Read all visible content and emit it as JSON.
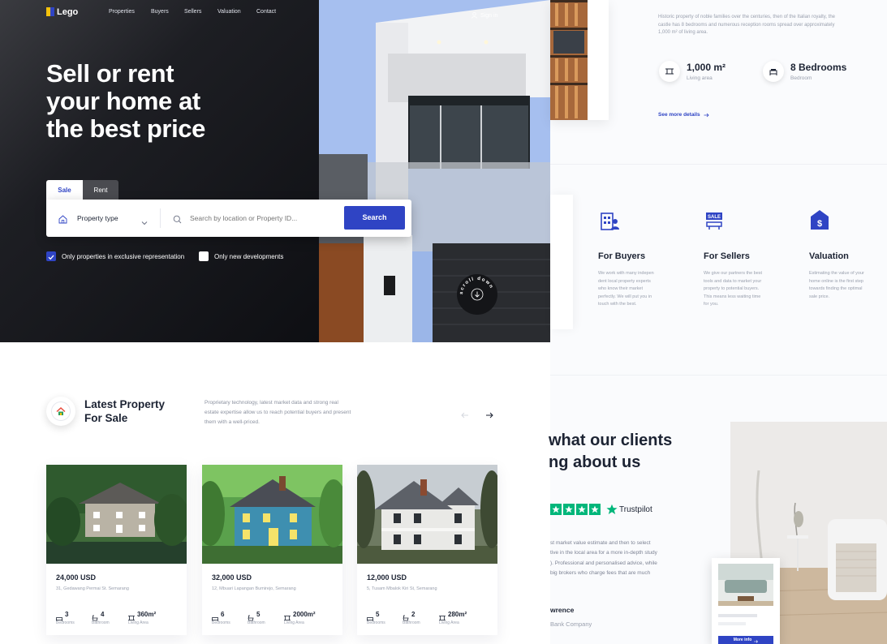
{
  "brand": {
    "name": "Lego"
  },
  "nav": {
    "items": [
      "Properties",
      "Buyers",
      "Sellers",
      "Valuation",
      "Contact"
    ],
    "sign_in": "Sign in"
  },
  "hero": {
    "title_lines": [
      "Sell or rent",
      "your home at",
      "the best price"
    ],
    "scroll_label": "scroll down"
  },
  "search": {
    "tabs": [
      "Sale",
      "Rent"
    ],
    "property_type": "Property type",
    "placeholder": "Search by location or Property ID...",
    "button": "Search",
    "checks": [
      {
        "label": "Only properties in exclusive representation",
        "checked": true
      },
      {
        "label": "Only new developments",
        "checked": false
      }
    ]
  },
  "detail": {
    "description": "Historic property of noble families over the centuries, then of the Italian royalty, the castle has 8 bedrooms and numerous reception rooms spread over approximately 1,000 m² of living area.",
    "desc_lines": [
      "Historic property of noble families over the centuries, then of the Italian royalty, the",
      "castle has 8 bedrooms and numerous reception rooms spread over approximately",
      "1,000 m² of living area."
    ],
    "stats": [
      {
        "value": "1,000 m²",
        "label": "Living area"
      },
      {
        "value": "8 Bedrooms",
        "label": "Bedroom"
      }
    ],
    "link": "See more details"
  },
  "services": [
    {
      "title": "For Buyers",
      "lines": [
        "We work with many indepen",
        "dent local property experts",
        "who know their market",
        "perfectly. We will put you in",
        "touch with the best."
      ]
    },
    {
      "title": "For Sellers",
      "lines": [
        "We give our partners the best",
        "tools and data to market your",
        "property to potential buyers.",
        "This means less waiting time",
        "for you."
      ]
    },
    {
      "title": "Valuation",
      "lines": [
        "Estimating the value of your",
        "home online is the first step",
        "towards finding the optimal",
        "sale price."
      ]
    }
  ],
  "latest": {
    "title_lines": [
      "Latest Property",
      "For Sale"
    ],
    "desc_lines": [
      "Proprietary technology, latest market data and strong real",
      "estate expertise allow us to reach potential buyers and present",
      "them with a well-priced."
    ]
  },
  "listings": [
    {
      "price": "24,000 USD",
      "address": "31, Gedawang Permai St. Semarang",
      "beds": "3",
      "baths": "4",
      "area": "360m²"
    },
    {
      "price": "32,000 USD",
      "address": "12, Mbuari Lapangan Bumirejo, Semarang",
      "beds": "6",
      "baths": "5",
      "area": "2000m²"
    },
    {
      "price": "12,000 USD",
      "address": "5, Tusam Mbalok Kiri St, Semarang",
      "beds": "5",
      "baths": "2",
      "area": "280m²"
    }
  ],
  "feature_labels": {
    "beds": "Bedrooms",
    "baths": "Bathroom",
    "area": "Living Area"
  },
  "testimonials": {
    "title_lines": [
      "what our clients",
      "ng about us"
    ],
    "trustpilot": "Trustpilot",
    "body_lines": [
      "st market value estimate and then to select",
      "tive in the local area for a more in-depth study",
      "). Professional and personalised advice, while",
      "big brokers who charge fees that are much"
    ],
    "author": "wrence",
    "company": "Bank Company",
    "more_info": "More info"
  },
  "colors": {
    "accent": "#2f44c4",
    "trustpilot": "#00b67a",
    "dark": "#1c2333"
  }
}
